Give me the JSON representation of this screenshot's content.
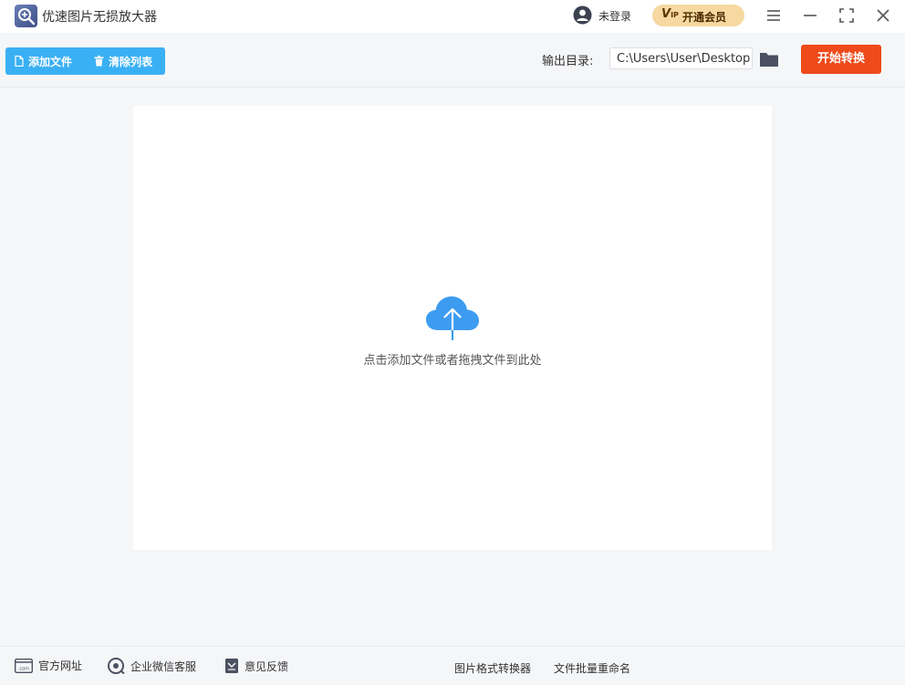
{
  "window": {
    "title": "优速图片无损放大器",
    "login_label": "未登录",
    "vip": {
      "badge": "V",
      "badge_sub": "IP",
      "label": "开通会员"
    },
    "controls": [
      "menu-icon",
      "minimize-icon",
      "maximize-icon",
      "close-icon"
    ]
  },
  "toolbar": {
    "add_file_label": "添加文件",
    "clear_list_label": "清除列表",
    "output_label": "输出目录:",
    "output_path": "C:\\Users\\User\\Desktop",
    "start_label": "开始转换"
  },
  "dropzone": {
    "hint": "点击添加文件或者拖拽文件到此处"
  },
  "footer": {
    "website": "官方网址",
    "website_icon_text": ".com",
    "wechat": "企业微信客服",
    "feedback": "意见反馈",
    "format_converter": "图片格式转换器",
    "batch_rename": "文件批量重命名"
  },
  "colors": {
    "accent_blue": "#3ab0f4",
    "start_red": "#ef4a1a",
    "vip_gold": "#f6d9a0",
    "cloud_blue": "#3d9cf0"
  }
}
